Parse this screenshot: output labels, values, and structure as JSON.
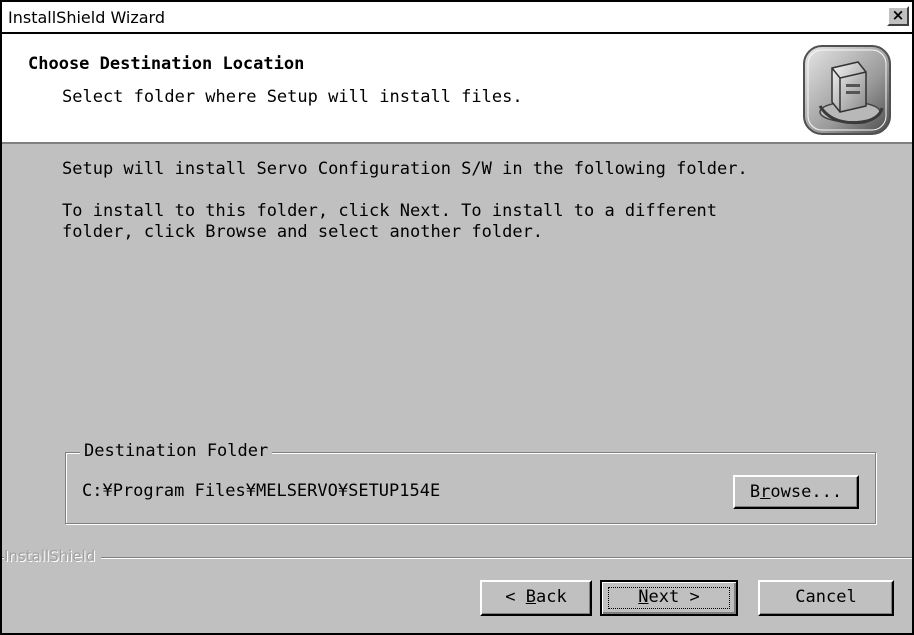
{
  "window": {
    "title": "InstallShield Wizard",
    "close_label": "×"
  },
  "header": {
    "title": "Choose Destination Location",
    "subtitle": "Select folder where Setup will install files.",
    "icon": "setup-computer-icon"
  },
  "body": {
    "line1": "Setup will install Servo Configuration S/W in the following folder.",
    "line2": "To install to this folder, click Next. To install to a different",
    "line3": "folder, click Browse and select another folder."
  },
  "destination": {
    "legend": "Destination Folder",
    "path": "C:¥Program Files¥MELSERVO¥SETUP154E",
    "browse": {
      "pre": "B",
      "accel": "r",
      "post": "owse..."
    }
  },
  "footer": {
    "brand": "InstallShield",
    "back": {
      "pre": "< ",
      "accel": "B",
      "post": "ack"
    },
    "next": {
      "pre": "",
      "accel": "N",
      "post": "ext >"
    },
    "cancel": "Cancel"
  },
  "colors": {
    "dialog_face": "#c0c0c0",
    "header_background": "#ffffff",
    "shadow": "#808080",
    "highlight": "#ffffff"
  }
}
